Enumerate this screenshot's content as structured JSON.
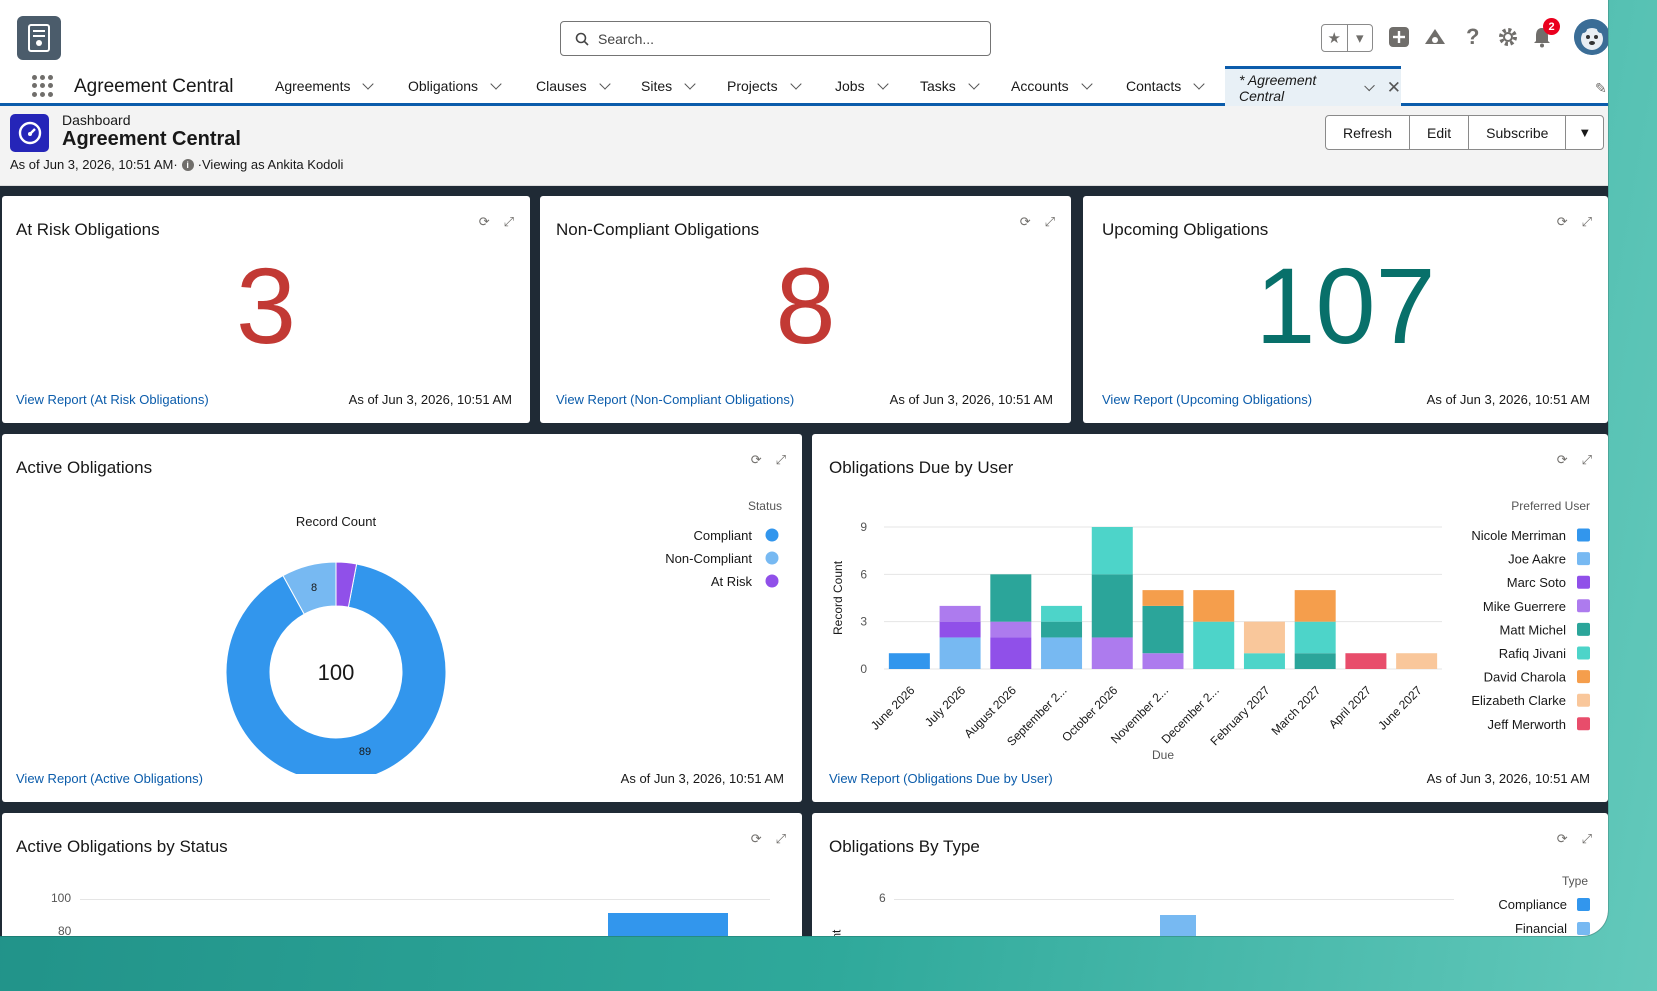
{
  "search": {
    "placeholder": "Search..."
  },
  "notifications": {
    "count": "2"
  },
  "nav": {
    "app_name": "Agreement Central",
    "items": [
      "Agreements",
      "Obligations",
      "Clauses",
      "Sites",
      "Projects",
      "Jobs",
      "Tasks",
      "Accounts",
      "Contacts"
    ],
    "active_tab": "* Agreement Central"
  },
  "header": {
    "crumb": "Dashboard",
    "title": "Agreement Central",
    "as_of": "As of Jun 3, 2026, 10:51 AM·",
    "viewing": "·Viewing as Ankita Kodoli",
    "buttons": {
      "refresh": "Refresh",
      "edit": "Edit",
      "subscribe": "Subscribe"
    }
  },
  "metrics": [
    {
      "title": "At Risk Obligations",
      "value": "3",
      "color": "#c23934",
      "link": "View Report (At Risk Obligations)",
      "ts": "As of Jun 3, 2026, 10:51 AM"
    },
    {
      "title": "Non-Compliant Obligations",
      "value": "8",
      "color": "#c23934",
      "link": "View Report (Non-Compliant Obligations)",
      "ts": "As of Jun 3, 2026, 10:51 AM"
    },
    {
      "title": "Upcoming Obligations",
      "value": "107",
      "color": "#08706a",
      "link": "View Report (Upcoming Obligations)",
      "ts": "As of Jun 3, 2026, 10:51 AM"
    }
  ],
  "active": {
    "title": "Active Obligations",
    "link": "View Report (Active Obligations)",
    "ts": "As of Jun 3, 2026, 10:51 AM"
  },
  "due": {
    "title": "Obligations Due by User",
    "link": "View Report (Obligations Due by User)",
    "ts": "As of Jun 3, 2026, 10:51 AM"
  },
  "status_card": {
    "title": "Active Obligations by Status",
    "ticks": [
      "100",
      "80"
    ]
  },
  "type_card": {
    "title": "Obligations By Type",
    "legend_title": "Type",
    "ytick": "6",
    "ylabel": "unt",
    "legend": [
      {
        "name": "Compliance",
        "color": "#3296ed"
      },
      {
        "name": "Financial",
        "color": "#77b9f2"
      }
    ]
  },
  "chart_data": [
    {
      "type": "pie",
      "chart": "donut",
      "title": "Record Count",
      "center_label": "100",
      "legend_title": "Status",
      "legend_position": "top-right",
      "slices": [
        {
          "name": "Compliant",
          "value": 89,
          "color": "#3296ed"
        },
        {
          "name": "Non-Compliant",
          "value": 8,
          "color": "#77b9f2"
        },
        {
          "name": "At Risk",
          "value": 3,
          "color": "#9050e9"
        }
      ]
    },
    {
      "type": "bar",
      "stacked": true,
      "xlabel": "Due",
      "ylabel": "Record Count",
      "ylim": [
        0,
        9
      ],
      "yticks": [
        0,
        3,
        6,
        9
      ],
      "legend_title": "Preferred User",
      "legend_position": "right",
      "categories": [
        "June 2026",
        "July 2026",
        "August 2026",
        "September 2...",
        "October 2026",
        "November 2...",
        "December 2...",
        "February 2027",
        "March 2027",
        "April 2027",
        "June 2027"
      ],
      "series": [
        {
          "name": "Nicole Merriman",
          "color": "#3296ed",
          "values": [
            1,
            0,
            0,
            0,
            0,
            0,
            0,
            0,
            0,
            0,
            0
          ]
        },
        {
          "name": "Joe Aakre",
          "color": "#77b9f2",
          "values": [
            0,
            2,
            0,
            2,
            0,
            0,
            0,
            0,
            0,
            0,
            0
          ]
        },
        {
          "name": "Marc Soto",
          "color": "#9050e9",
          "values": [
            0,
            1,
            2,
            0,
            0,
            0,
            0,
            0,
            0,
            0,
            0
          ]
        },
        {
          "name": "Mike Guerrere",
          "color": "#ad7bee",
          "values": [
            0,
            1,
            1,
            0,
            2,
            1,
            0,
            0,
            0,
            0,
            0
          ]
        },
        {
          "name": "Matt Michel",
          "color": "#2ba59a",
          "values": [
            0,
            0,
            3,
            1,
            4,
            3,
            0,
            0,
            1,
            0,
            0
          ]
        },
        {
          "name": "Rafiq Jivani",
          "color": "#4dd4c9",
          "values": [
            0,
            0,
            0,
            1,
            3,
            0,
            3,
            1,
            2,
            0,
            0
          ]
        },
        {
          "name": "David Charola",
          "color": "#f59e4c",
          "values": [
            0,
            0,
            0,
            0,
            0,
            1,
            2,
            0,
            2,
            0,
            0
          ]
        },
        {
          "name": "Elizabeth Clarke",
          "color": "#f9c79b",
          "values": [
            0,
            0,
            0,
            0,
            0,
            0,
            0,
            2,
            0,
            0,
            1
          ]
        },
        {
          "name": "Jeff Merworth",
          "color": "#e84d6b",
          "values": [
            0,
            0,
            0,
            0,
            0,
            0,
            0,
            0,
            0,
            1,
            0
          ]
        }
      ]
    }
  ]
}
